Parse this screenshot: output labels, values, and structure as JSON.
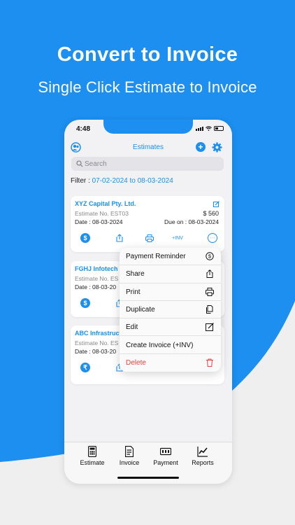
{
  "hero": {
    "title": "Convert to Invoice",
    "subtitle": "Single Click Estimate to Invoice"
  },
  "colors": {
    "accent": "#1c8ff0",
    "danger": "#e5423a",
    "background": "#f2f2f4"
  },
  "status_bar": {
    "time": "4:48"
  },
  "navbar": {
    "title": "Estimates"
  },
  "search": {
    "placeholder": "Search"
  },
  "filter": {
    "label": "Filter :",
    "range": "07-02-2024 to 08-03-2024"
  },
  "estimates": [
    {
      "client": "XYZ Capital Pty. Ltd.",
      "estimate_no": "Estimate No. EST03",
      "amount": "$ 560",
      "date": "Date : 08-03-2024",
      "due": "Due on : 08-03-2024",
      "currency_icon": "$",
      "convert_label": "+INV"
    },
    {
      "client": "FGHJ Infotech I",
      "estimate_no": "Estimate No. ES",
      "date": "Date : 08-03-20",
      "currency_icon": "$"
    },
    {
      "client": "ABC Infrastruct",
      "estimate_no": "Estimate No. ES",
      "date": "Date : 08-03-20",
      "currency_icon": "₹"
    }
  ],
  "context_menu": [
    {
      "label": "Payment Reminder",
      "icon": "dollar-circle-icon"
    },
    {
      "label": "Share",
      "icon": "share-icon"
    },
    {
      "label": "Print",
      "icon": "printer-icon"
    },
    {
      "label": "Duplicate",
      "icon": "duplicate-icon"
    },
    {
      "label": "Edit",
      "icon": "edit-icon"
    },
    {
      "label": "Create Invoice (+INV)",
      "icon": ""
    },
    {
      "label": "Delete",
      "icon": "trash-icon"
    }
  ],
  "tabs": [
    {
      "label": "Estimate",
      "icon": "calculator-icon"
    },
    {
      "label": "Invoice",
      "icon": "invoice-icon"
    },
    {
      "label": "Payment",
      "icon": "payment-icon"
    },
    {
      "label": "Reports",
      "icon": "reports-icon"
    }
  ]
}
